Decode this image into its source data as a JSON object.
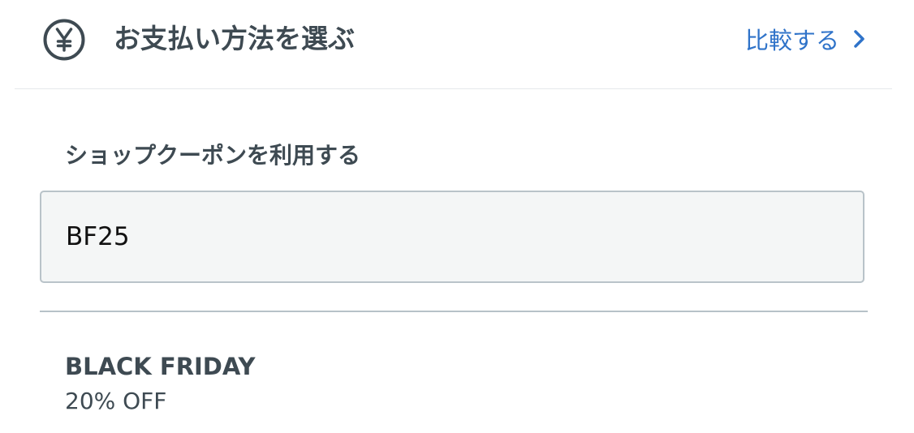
{
  "header": {
    "icon": "yen-icon",
    "title": "お支払い方法を選ぶ",
    "compare_label": "比較する",
    "compare_icon": "chevron-right-icon"
  },
  "coupon": {
    "label": "ショップクーポンを利用する",
    "value": "BF25"
  },
  "promo": {
    "title": "BLACK FRIDAY",
    "discount": "20% OFF"
  },
  "colors": {
    "text": "#3e4a52",
    "link": "#2f73c9",
    "input_bg": "#f4f6f6",
    "input_border": "#b9c3c9"
  }
}
